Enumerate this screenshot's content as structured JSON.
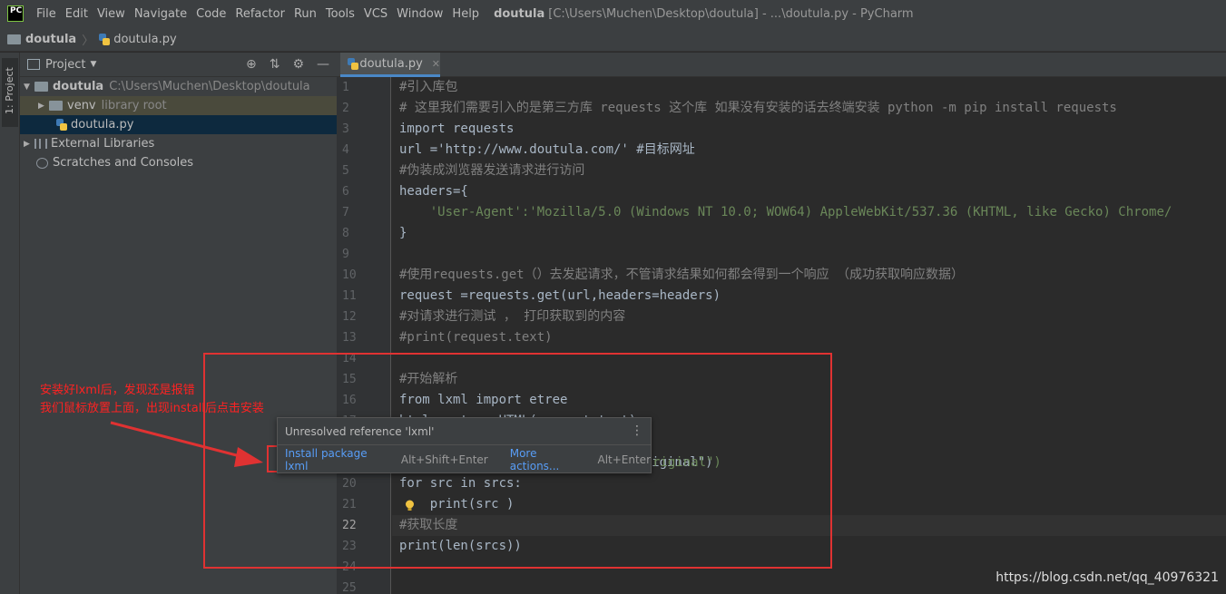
{
  "title_bar": {
    "logo_text": "PC",
    "menu": [
      "File",
      "Edit",
      "View",
      "Navigate",
      "Code",
      "Refactor",
      "Run",
      "Tools",
      "VCS",
      "Window",
      "Help"
    ],
    "project_name": "doutula",
    "window_title": "[C:\\Users\\Muchen\\Desktop\\doutula] - ...\\doutula.py - PyCharm"
  },
  "breadcrumb": {
    "root": "doutula",
    "file": "doutula.py"
  },
  "toolstrip": {
    "tab_label": "1: Project"
  },
  "project_panel": {
    "title": "Project",
    "tree": [
      {
        "label": "doutula",
        "detail": "C:\\Users\\Muchen\\Desktop\\doutula"
      },
      {
        "label": "venv",
        "detail": "library root"
      },
      {
        "label": "doutula.py",
        "detail": ""
      },
      {
        "label": "External Libraries",
        "detail": ""
      },
      {
        "label": "Scratches and Consoles",
        "detail": ""
      }
    ]
  },
  "editor": {
    "tab_label": "doutula.py",
    "line_numbers": [
      "1",
      "2",
      "3",
      "4",
      "5",
      "6",
      "7",
      "8",
      "9",
      "10",
      "11",
      "12",
      "13",
      "14",
      "15",
      "16",
      "17",
      "18",
      "19",
      "20",
      "21",
      "22",
      "23",
      "24",
      "25"
    ],
    "current_line": "22",
    "lines": [
      "#引入库包",
      "# 这里我们需要引入的是第三方库 requests 这个库 如果没有安装的话去终端安装 python -m pip install requests",
      "import requests",
      "url ='http://www.doutula.com/' #目标网址",
      "#伪装成浏览器发送请求进行访问",
      "headers={",
      "    'User-Agent':'Mozilla/5.0 (Windows NT 10.0; WOW64) AppleWebKit/537.36 (KHTML, like Gecko) Chrome/",
      "}",
      "",
      "#使用requests.get（）去发起请求，不管请求结果如何都会得到一个响应 （成功获取响应数据）",
      "request =requests.get(url,headers=headers)",
      "#对请求进行测试 ， 打印获取到的内容",
      "#print(request.text)",
      "",
      "#开始解析",
      "from lxml import etree",
      "html = etree.HTML(request.text)",
      "",
      "srcs = html.xpath('//img/@data-original\")",
      "for src in srcs:",
      "    print(src )",
      "#获取长度",
      "print(len(srcs))",
      "",
      ""
    ],
    "partial_visible_tail": "riginal\")"
  },
  "popup": {
    "title": "Unresolved reference 'lxml'",
    "install_action": "Install package lxml",
    "install_shortcut": "Alt+Shift+Enter",
    "more_actions": "More actions...",
    "more_shortcut": "Alt+Enter"
  },
  "annotation": {
    "line1": "安装好lxml后，发现还是报错",
    "line2": "我们鼠标放置上面，出现install后点击安装"
  },
  "watermark": "https://blog.csdn.net/qq_40976321",
  "colors": {
    "annotation_red": "#e03232",
    "accent_blue": "#4a88c7",
    "link_blue": "#589df6"
  }
}
